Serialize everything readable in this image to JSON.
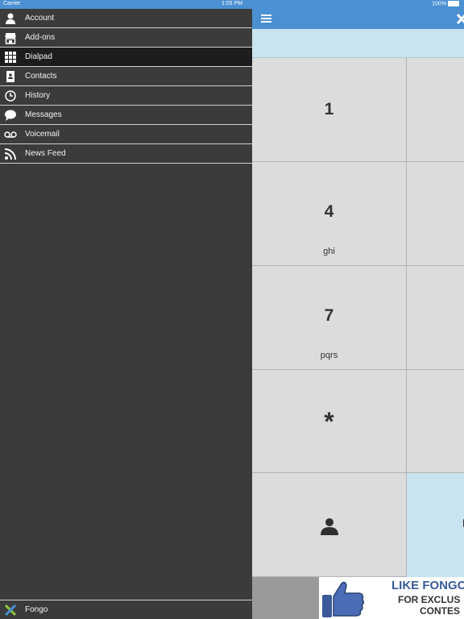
{
  "status_bar": {
    "carrier": "Carrier",
    "time": "1:05 PM",
    "battery": "100%"
  },
  "sidebar": {
    "items": [
      {
        "label": "Account",
        "icon": "person-icon"
      },
      {
        "label": "Add-ons",
        "icon": "store-icon"
      },
      {
        "label": "Dialpad",
        "icon": "dialpad-grid-icon",
        "active": true
      },
      {
        "label": "Contacts",
        "icon": "contact-book-icon"
      },
      {
        "label": "History",
        "icon": "clock-icon"
      },
      {
        "label": "Messages",
        "icon": "chat-bubble-icon"
      },
      {
        "label": "Voicemail",
        "icon": "voicemail-icon"
      },
      {
        "label": "News Feed",
        "icon": "rss-icon"
      }
    ],
    "footer": {
      "label": "Fongo",
      "icon": "fongo-logo-icon"
    }
  },
  "dialpad": {
    "keys": [
      {
        "digit": "1",
        "letters": ""
      },
      {
        "digit": "4",
        "letters": "ghi"
      },
      {
        "digit": "7",
        "letters": "pqrs"
      },
      {
        "digit": "*",
        "letters": ""
      }
    ]
  },
  "ad": {
    "line1": "LIKE FONGO",
    "line2": "FOR EXCLUS",
    "line3": "CONTES"
  },
  "colors": {
    "accent": "#4a90d2",
    "sidebar_bg": "#3b3b3b",
    "active_item_bg": "#1d1d1d",
    "display_bg": "#c9e3f0",
    "key_bg": "#dcdcdc"
  }
}
